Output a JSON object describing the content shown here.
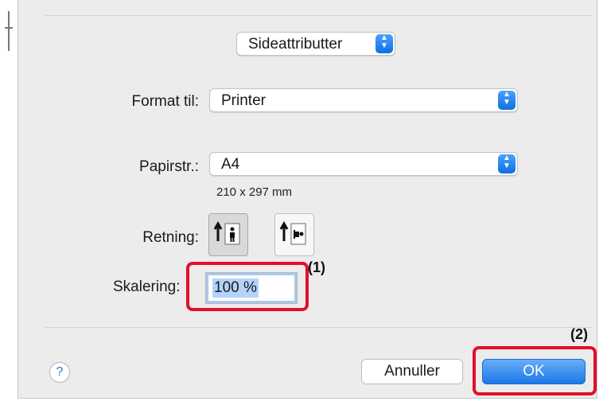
{
  "dialog": {
    "section_popup": "Sideattributter",
    "format_for": {
      "label": "Format til:",
      "value": "Printer"
    },
    "paper_size": {
      "label": "Papirstr.:",
      "value": "A4",
      "dimensions": "210 x 297 mm"
    },
    "orientation": {
      "label": "Retning:",
      "options": [
        "portrait",
        "landscape"
      ],
      "selected": "portrait"
    },
    "scale": {
      "label": "Skalering:",
      "value": "100 %"
    },
    "buttons": {
      "help": "?",
      "cancel": "Annuller",
      "ok": "OK"
    }
  },
  "callouts": [
    "(1)",
    "(2)"
  ],
  "colors": {
    "accent": "#1d78e8",
    "callout": "#e0102a",
    "background": "#ececec"
  }
}
